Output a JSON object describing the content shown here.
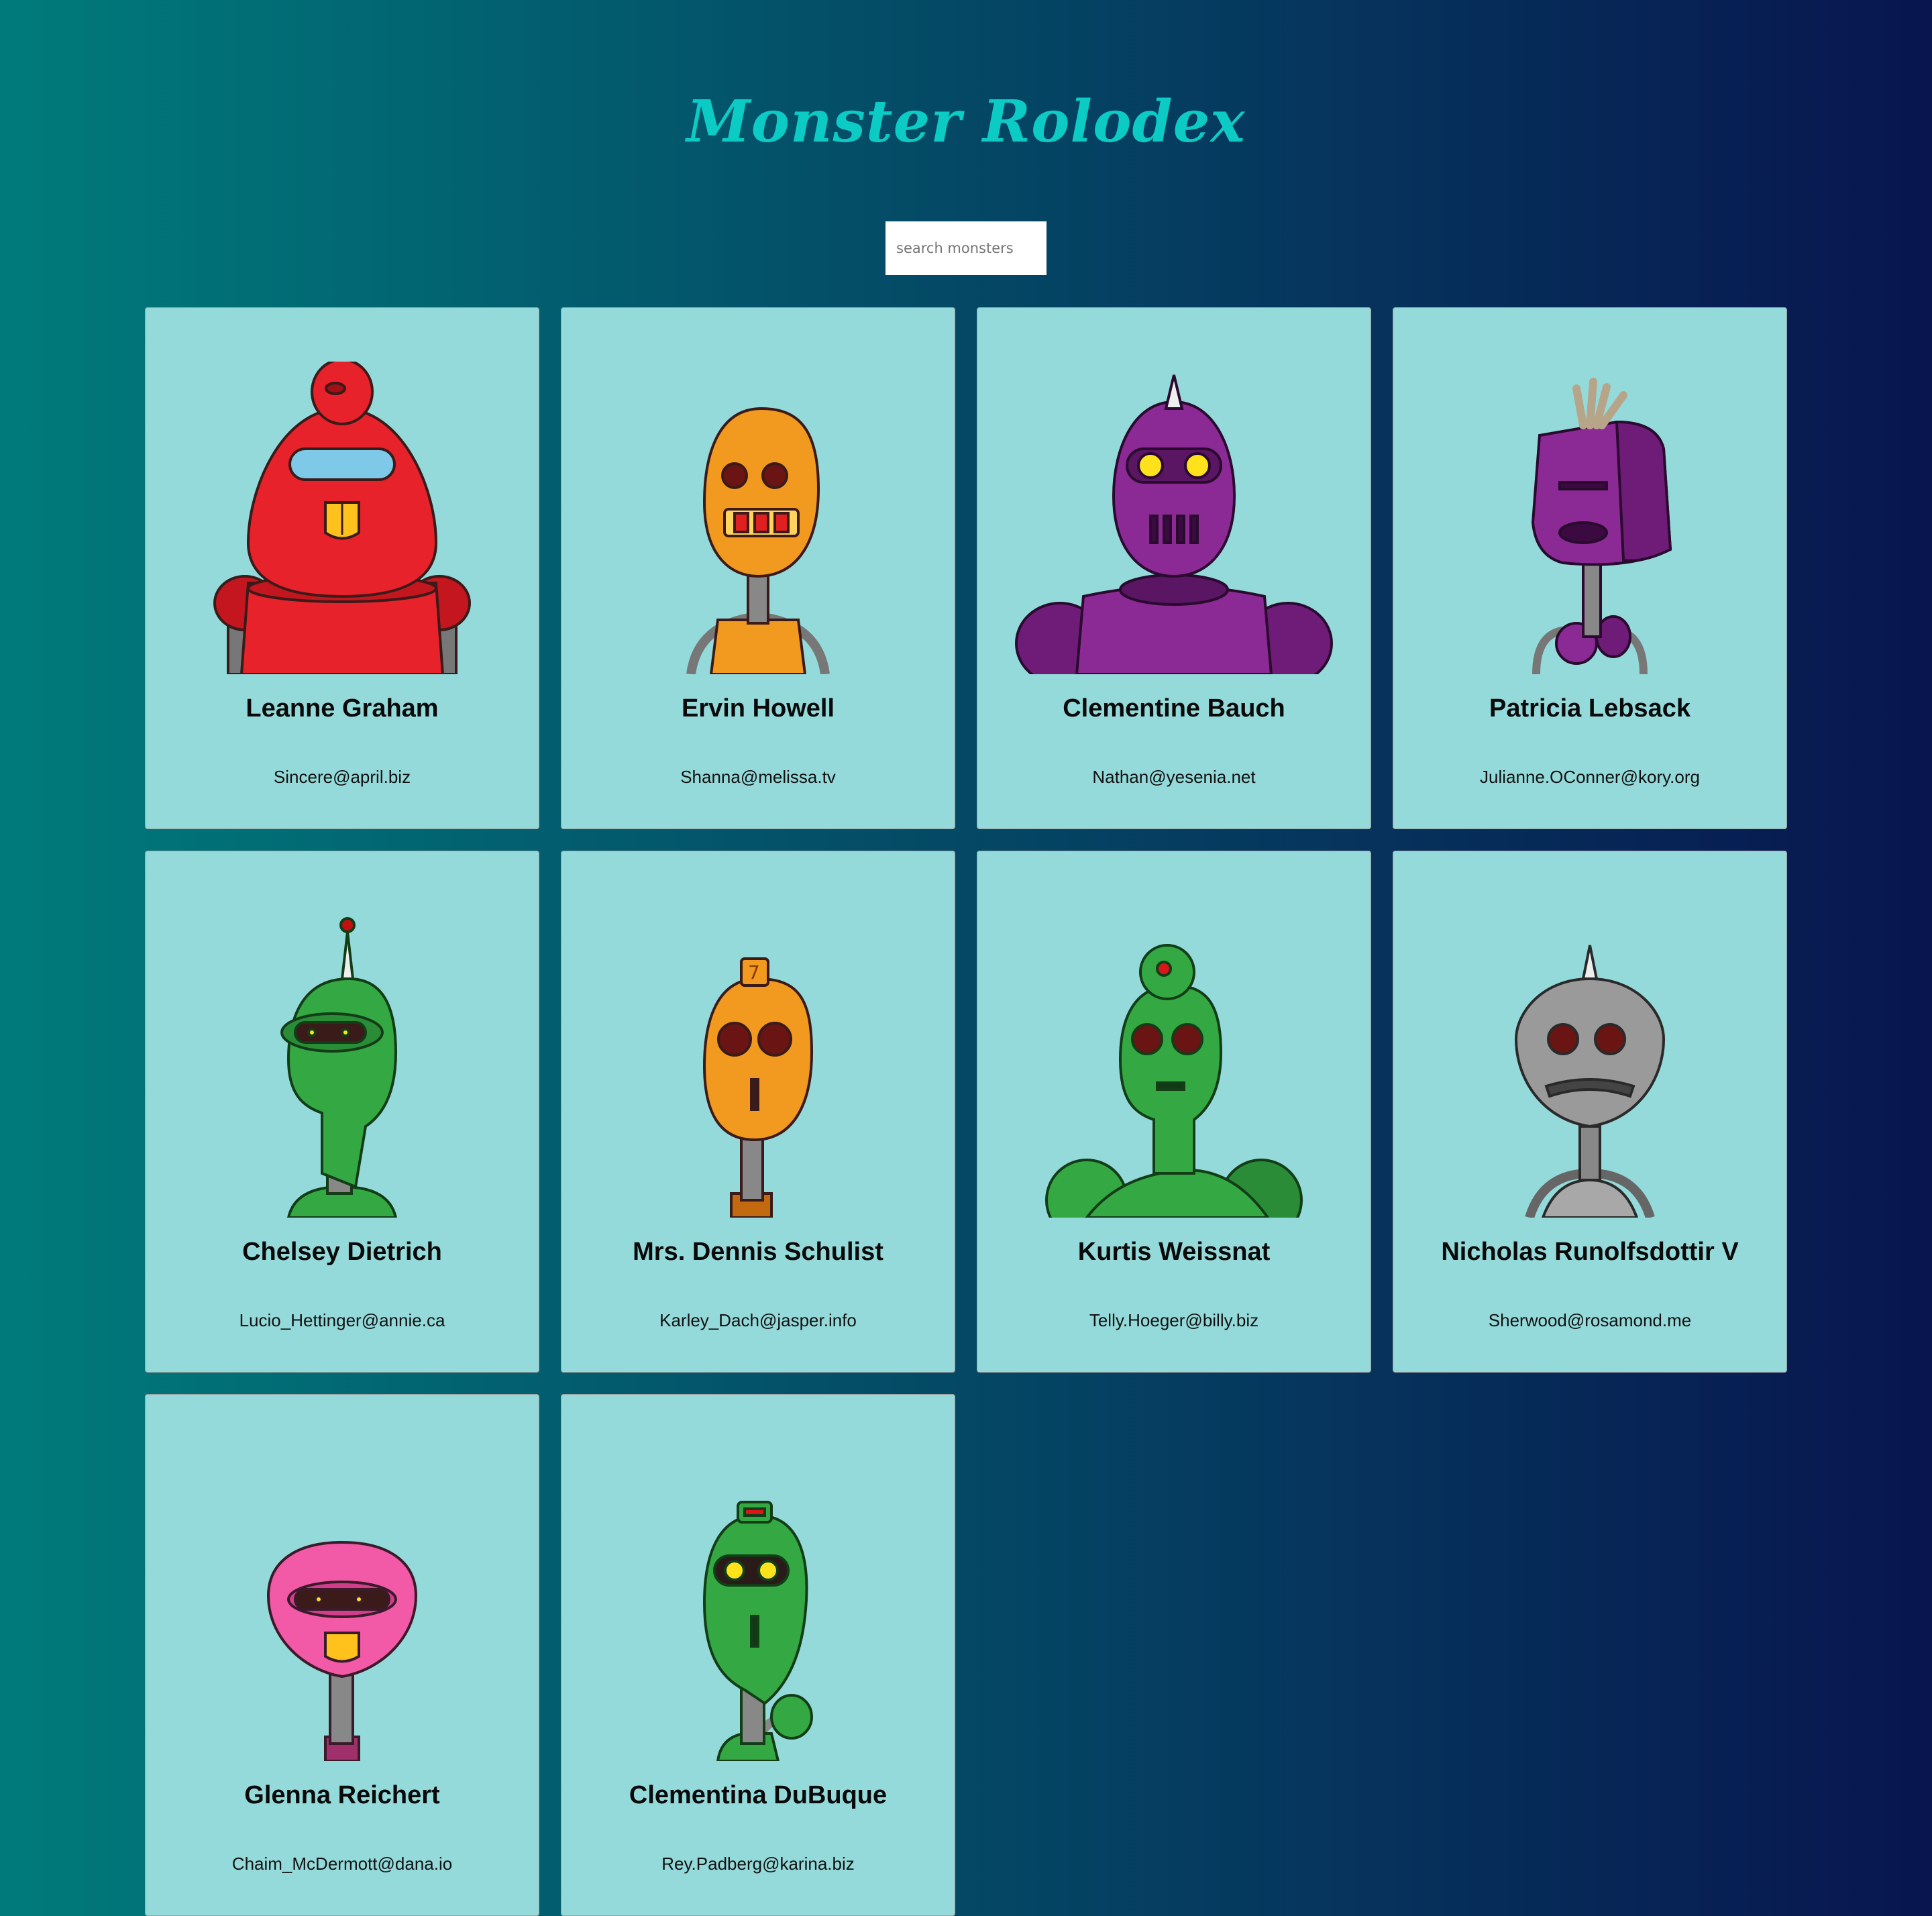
{
  "app": {
    "title": "Monster Rolodex"
  },
  "search": {
    "placeholder": "search monsters",
    "value": ""
  },
  "monsters": [
    {
      "name": "Leanne Graham",
      "email": "Sincere@april.biz",
      "color": "#e8222a",
      "icon": "red-robot-icon"
    },
    {
      "name": "Ervin Howell",
      "email": "Shanna@melissa.tv",
      "color": "#f29a1f",
      "icon": "orange-robot-icon"
    },
    {
      "name": "Clementine Bauch",
      "email": "Nathan@yesenia.net",
      "color": "#8c2a95",
      "icon": "purple-robot-icon"
    },
    {
      "name": "Patricia Lebsack",
      "email": "Julianne.OConner@kory.org",
      "color": "#8c2a95",
      "icon": "purple-robot-icon"
    },
    {
      "name": "Chelsey Dietrich",
      "email": "Lucio_Hettinger@annie.ca",
      "color": "#34a843",
      "icon": "green-robot-icon"
    },
    {
      "name": "Mrs. Dennis Schulist",
      "email": "Karley_Dach@jasper.info",
      "color": "#f29a1f",
      "icon": "orange-robot-icon"
    },
    {
      "name": "Kurtis Weissnat",
      "email": "Telly.Hoeger@billy.biz",
      "color": "#34a843",
      "icon": "green-robot-icon"
    },
    {
      "name": "Nicholas Runolfsdottir V",
      "email": "Sherwood@rosamond.me",
      "color": "#9a9a9a",
      "icon": "gray-robot-icon"
    },
    {
      "name": "Glenna Reichert",
      "email": "Chaim_McDermott@dana.io",
      "color": "#f25aa8",
      "icon": "pink-robot-icon"
    },
    {
      "name": "Clementina DuBuque",
      "email": "Rey.Padberg@karina.biz",
      "color": "#34a843",
      "icon": "green-robot-icon"
    }
  ]
}
